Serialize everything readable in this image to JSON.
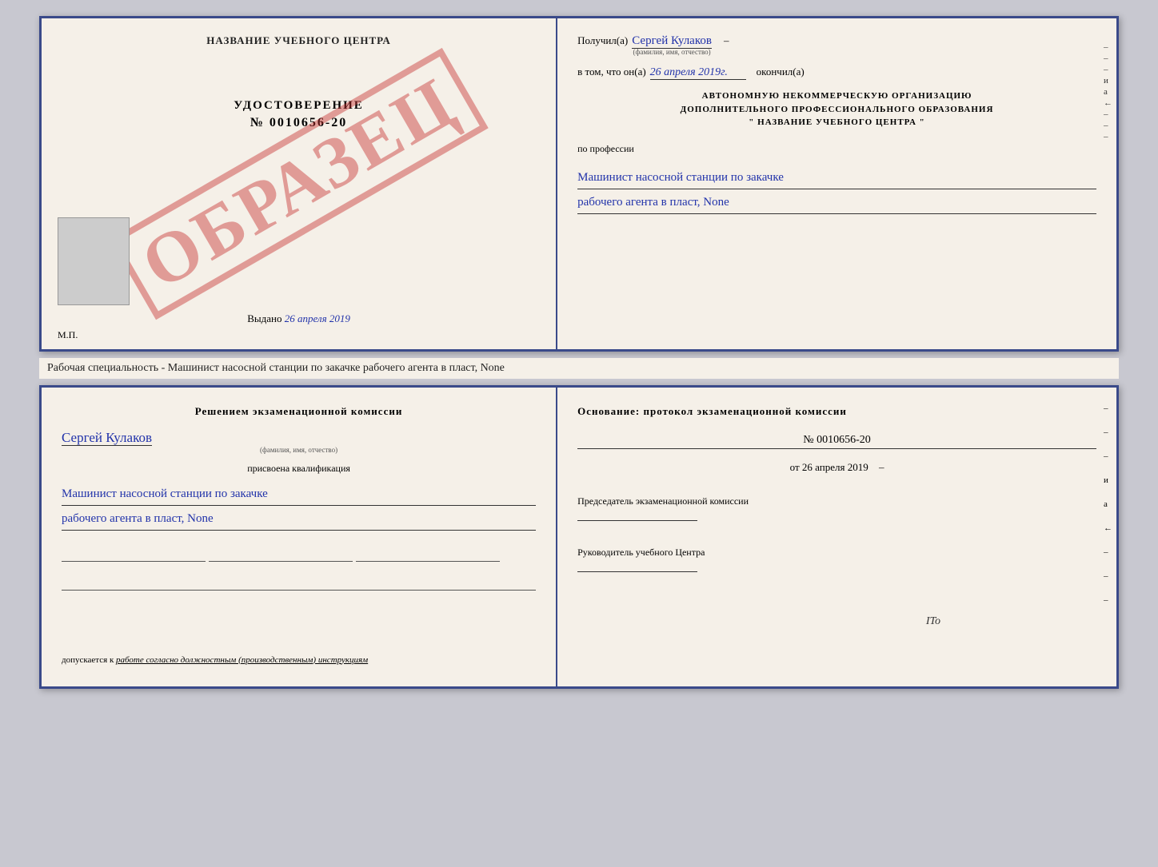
{
  "cert_top": {
    "left": {
      "title": "НАЗВАНИЕ УЧЕБНОГО ЦЕНТРА",
      "watermark": "ОБРАЗЕЦ",
      "udostoverenie_label": "УДОСТОВЕРЕНИЕ",
      "number": "№ 0010656-20",
      "vydano": "Выдано",
      "vydano_date": "26 апреля 2019",
      "mp": "М.П."
    },
    "right": {
      "poluchil_label": "Получил(а)",
      "poluchil_name": "Сергей Кулаков",
      "fio_sub": "(фамилия, имя, отчество)",
      "dash": "–",
      "vtom_label": "в том, что он(а)",
      "vtom_date": "26 апреля 2019г.",
      "okonchil": "окончил(а)",
      "org_line1": "АВТОНОМНУЮ НЕКОММЕРЧЕСКУЮ ОРГАНИЗАЦИЮ",
      "org_line2": "ДОПОЛНИТЕЛЬНОГО ПРОФЕССИОНАЛЬНОГО ОБРАЗОВАНИЯ",
      "org_line3": "\" НАЗВАНИЕ УЧЕБНОГО ЦЕНТРА \"",
      "po_professii": "по профессии",
      "prof_line1": "Машинист насосной станции по закачке",
      "prof_line2": "рабочего агента в пласт, None"
    }
  },
  "specialty_text": "Рабочая специальность - Машинист насосной станции по закачке рабочего агента в пласт, None",
  "cert_bottom": {
    "left": {
      "resheniem": "Решением экзаменационной комиссии",
      "name": "Сергей Кулаков",
      "fio_sub": "(фамилия, имя, отчество)",
      "prisvoena": "присвоена квалификация",
      "qual_line1": "Машинист насосной станции по закачке",
      "qual_line2": "рабочего агента в пласт, None",
      "dopuskaetsya_label": "допускается к",
      "dopuskaetsya_text": "работе согласно должностным (производственным) инструкциям"
    },
    "right": {
      "osnovanie": "Основание: протокол экзаменационной комиссии",
      "number": "№ 0010656-20",
      "ot_label": "от",
      "ot_date": "26 апреля 2019",
      "predsedatel_label": "Председатель экзаменационной комиссии",
      "rukovoditel_label": "Руководитель учебного Центра",
      "ito": "ITo"
    }
  }
}
